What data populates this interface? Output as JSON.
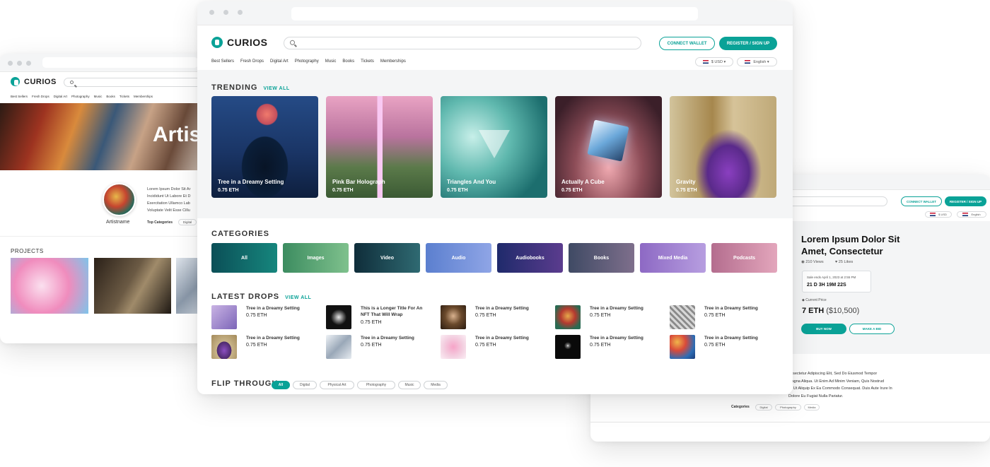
{
  "left_window": {
    "brand": "CURIOS",
    "nav": [
      "Best Sellers",
      "Fresh Drops",
      "Digital Art",
      "Photography",
      "Music",
      "Books",
      "Tickets",
      "Memberships"
    ],
    "hero_text": "Artis",
    "artist_name": "Artistname",
    "bio_lines": [
      "Lorem Ipsum Dolor Sit Ar",
      "Incididunt Ut Labore Et D",
      "Exercitation Ullamco Lab",
      "Voluptate Velit Esse Cillu"
    ],
    "top_categories_label": "Top Categories",
    "top_category": "Digital",
    "projects_title": "PROJECTS"
  },
  "main": {
    "brand": "CURIOS",
    "connect_wallet": "CONNECT WALLET",
    "register": "REGISTER / SIGN UP",
    "nav": [
      "Best Sellers",
      "Fresh Drops",
      "Digital Art",
      "Photography",
      "Music",
      "Books",
      "Tickets",
      "Memberships"
    ],
    "currency": "$ USD",
    "language": "English",
    "trending_title": "TRENDING",
    "view_all": "VIEW ALL",
    "trending": [
      {
        "title": "Tree in a Dreamy Setting",
        "price": "0.75 ETH"
      },
      {
        "title": "Pink Bar Holograph",
        "price": "0.75 ETH"
      },
      {
        "title": "Triangles And You",
        "price": "0.75 ETH"
      },
      {
        "title": "Actually A Cube",
        "price": "0.75 ETH"
      },
      {
        "title": "Gravity",
        "price": "0.75 ETH"
      }
    ],
    "categories_title": "CATEGORIES",
    "categories": [
      "All",
      "Images",
      "Video",
      "Audio",
      "Audiobooks",
      "Books",
      "Mixed Media",
      "Podcasts"
    ],
    "latest_title": "LATEST DROPS",
    "latest_view_all": "VIEW ALL",
    "drops": [
      {
        "title": "Tree in a Dreamy Setting",
        "price": "0.75 ETH"
      },
      {
        "title": "This is a Longer Title For An NFT That Will Wrap",
        "price": "0.75 ETH"
      },
      {
        "title": "Tree in a Dreamy Setting",
        "price": "0.75 ETH"
      },
      {
        "title": "Tree in a Dreamy Setting",
        "price": "0.75 ETH"
      },
      {
        "title": "Tree in a Dreamy Setting",
        "price": "0.75 ETH"
      },
      {
        "title": "Tree in a Dreamy Setting",
        "price": "0.75 ETH"
      },
      {
        "title": "Tree in a Dreamy Setting",
        "price": "0.75 ETH"
      },
      {
        "title": "Tree in a Dreamy Setting",
        "price": "0.75 ETH"
      },
      {
        "title": "Tree in a Dreamy Setting",
        "price": "0.75 ETH"
      },
      {
        "title": "Tree in a Dreamy Setting",
        "price": "0.75 ETH"
      }
    ],
    "flip_title": "FLIP THROUGH",
    "flip_chips": [
      "All",
      "Digital",
      "Physical Art",
      "Photography",
      "Music",
      "Media"
    ]
  },
  "right_window": {
    "connect_wallet": "CONNECT WALLET",
    "register": "REGISTER / SIGN UP",
    "currency": "$ USD",
    "language": "English",
    "title": "Lorem Ipsum Dolor Sit Amet, Consectetur",
    "views": "210 Views",
    "likes": "25 Likes",
    "sale_ends": "Sale ends April 1, 2023 at 2:55 PM",
    "countdown": "21 D  3H  19M  22S",
    "current_price_label": "Current Price",
    "price_eth": "7 ETH",
    "price_usd": "($10,500)",
    "buy_now": "BUY NOW",
    "make_bid": "MAKE A BID",
    "desc_lines": [
      "onsectetur Adipiscing Elit, Sed Do Eiusmod Tempor",
      "Magna Aliqua. Ut Enim Ad Minim Veniam, Quis Nostrud",
      "isi Ut Aliquip Ex Ea Commodo Consequat. Duis Aute Irure In",
      "Dolore Eu Fugiat Nulla Pariatur."
    ],
    "categories_label": "Categories",
    "categories": [
      "Digital",
      "Photography",
      "Media"
    ]
  },
  "colors": {
    "accent": "#0aa297",
    "text": "#1c1c1c",
    "panel": "#f4f5f6"
  }
}
